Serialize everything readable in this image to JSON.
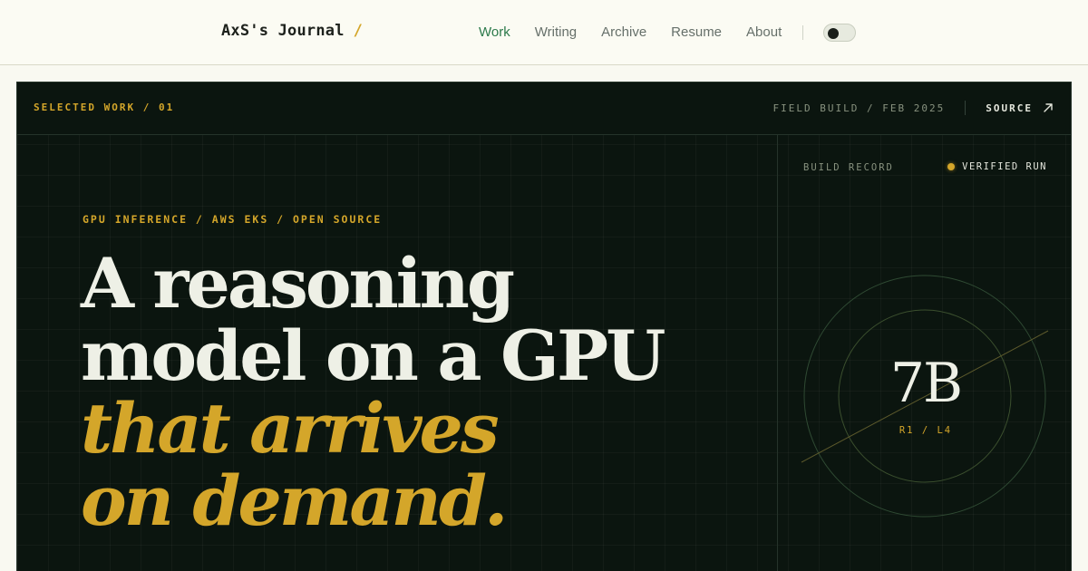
{
  "header": {
    "brand": "AxS's Journal",
    "brand_slash": "/",
    "nav": [
      {
        "label": "Work",
        "active": true
      },
      {
        "label": "Writing",
        "active": false
      },
      {
        "label": "Archive",
        "active": false
      },
      {
        "label": "Resume",
        "active": false
      },
      {
        "label": "About",
        "active": false
      }
    ],
    "theme_toggle": {
      "icon": "theme-toggle-icon",
      "state": "dark"
    }
  },
  "card": {
    "eyebrow": "SELECTED WORK / 01",
    "field_build": "FIELD BUILD / FEB 2025",
    "source_label": "SOURCE",
    "source_icon": "arrow-up-right-icon",
    "tags": "GPU INFERENCE / AWS EKS / OPEN SOURCE",
    "headline": {
      "line1": "A reasoning",
      "line2": "model on a GPU",
      "line3": "that arrives",
      "line4": "on demand."
    },
    "panel": {
      "build_record": "BUILD RECORD",
      "status": "VERIFIED RUN",
      "big_value": "7B",
      "sub_value": "R1 / L4"
    }
  },
  "colors": {
    "accent": "#d4a62a",
    "nav_active": "#2c7a4b",
    "card_bg": "#0b150f",
    "page_bg": "#f9f9f1"
  }
}
